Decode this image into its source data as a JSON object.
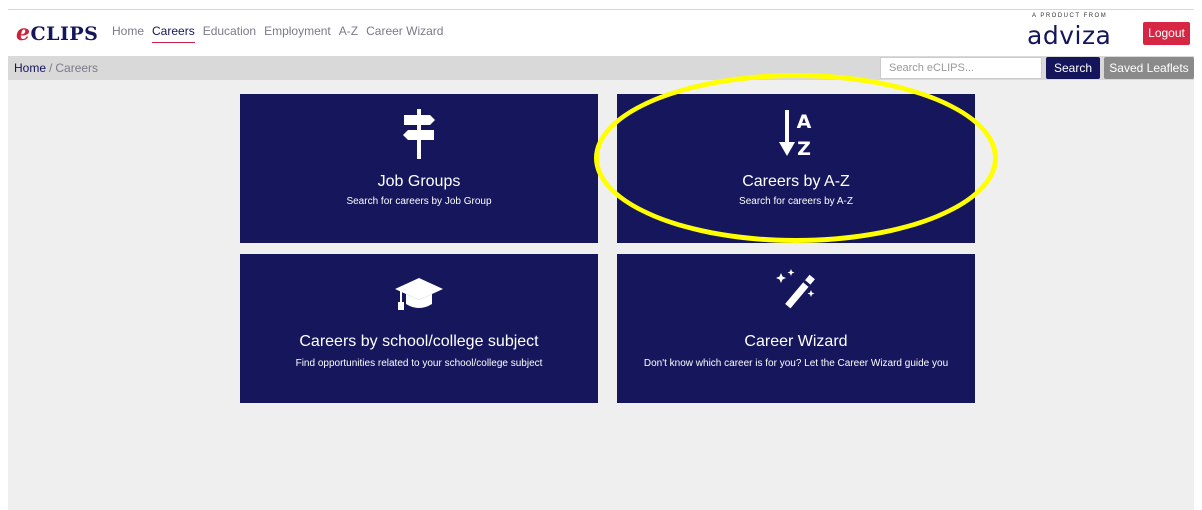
{
  "header": {
    "logo_prefix": "e",
    "logo_text": "CLIPS",
    "nav": [
      "Home",
      "Careers",
      "Education",
      "Employment",
      "A-Z",
      "Career Wizard"
    ],
    "active_nav": "Careers",
    "product_from": "A PRODUCT FROM",
    "brand_a": "adv",
    "brand_b": "i",
    "brand_c": "za",
    "logout_label": "Logout"
  },
  "breadcrumb": {
    "home": "Home",
    "separator": "/",
    "current": "Careers"
  },
  "search": {
    "placeholder": "Search eCLIPS...",
    "button_label": "Search",
    "saved_label": "Saved Leaflets"
  },
  "cards": [
    {
      "title": "Job Groups",
      "subtitle": "Search for careers by Job Group",
      "icon": "signpost-icon"
    },
    {
      "title": "Careers by A-Z",
      "subtitle": "Search for careers by A-Z",
      "icon": "sort-alpha-down-icon",
      "icon_top": "A",
      "icon_bottom": "Z"
    },
    {
      "title": "Careers by school/college subject",
      "subtitle": "Find opportunities related to your school/college subject",
      "icon": "graduation-cap-icon"
    },
    {
      "title": "Career Wizard",
      "subtitle": "Don't know which career is for you? Let the Career Wizard guide you",
      "icon": "magic-wand-icon"
    }
  ],
  "colors": {
    "card": "#15165c",
    "brand_red": "#d72643",
    "highlight": "#ffff00"
  }
}
